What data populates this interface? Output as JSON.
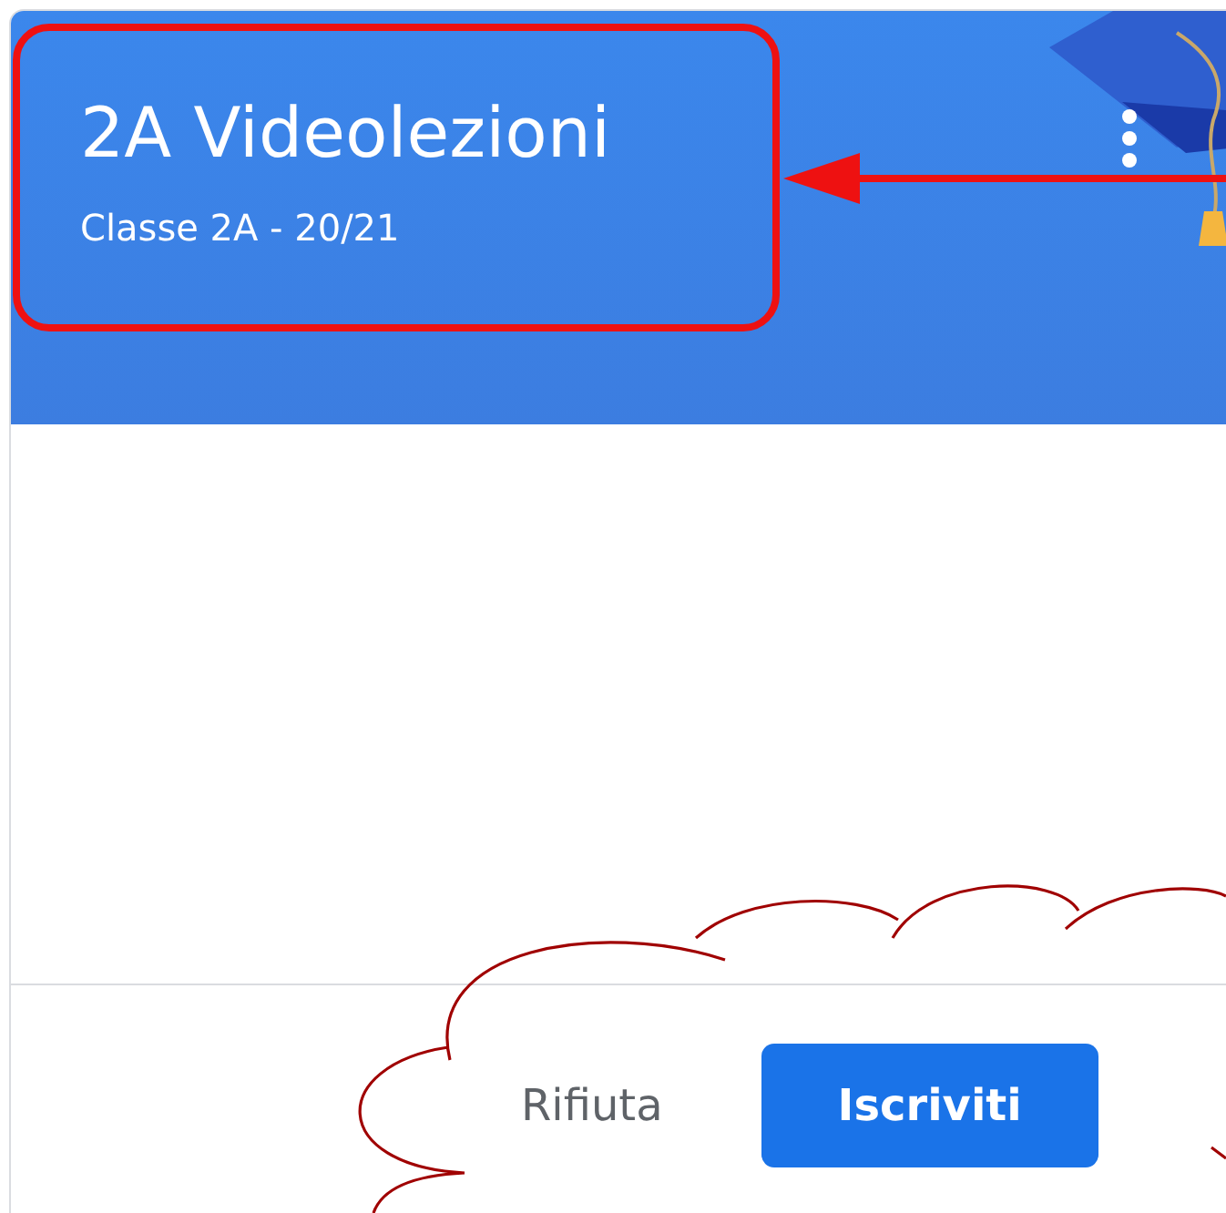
{
  "card": {
    "title": "2A Videolezioni",
    "subtitle": "Classe 2A - 20/21"
  },
  "buttons": [
    {
      "label": "Rifiuta",
      "kind": "text"
    },
    {
      "label": "Iscriviti",
      "kind": "primary"
    }
  ]
}
